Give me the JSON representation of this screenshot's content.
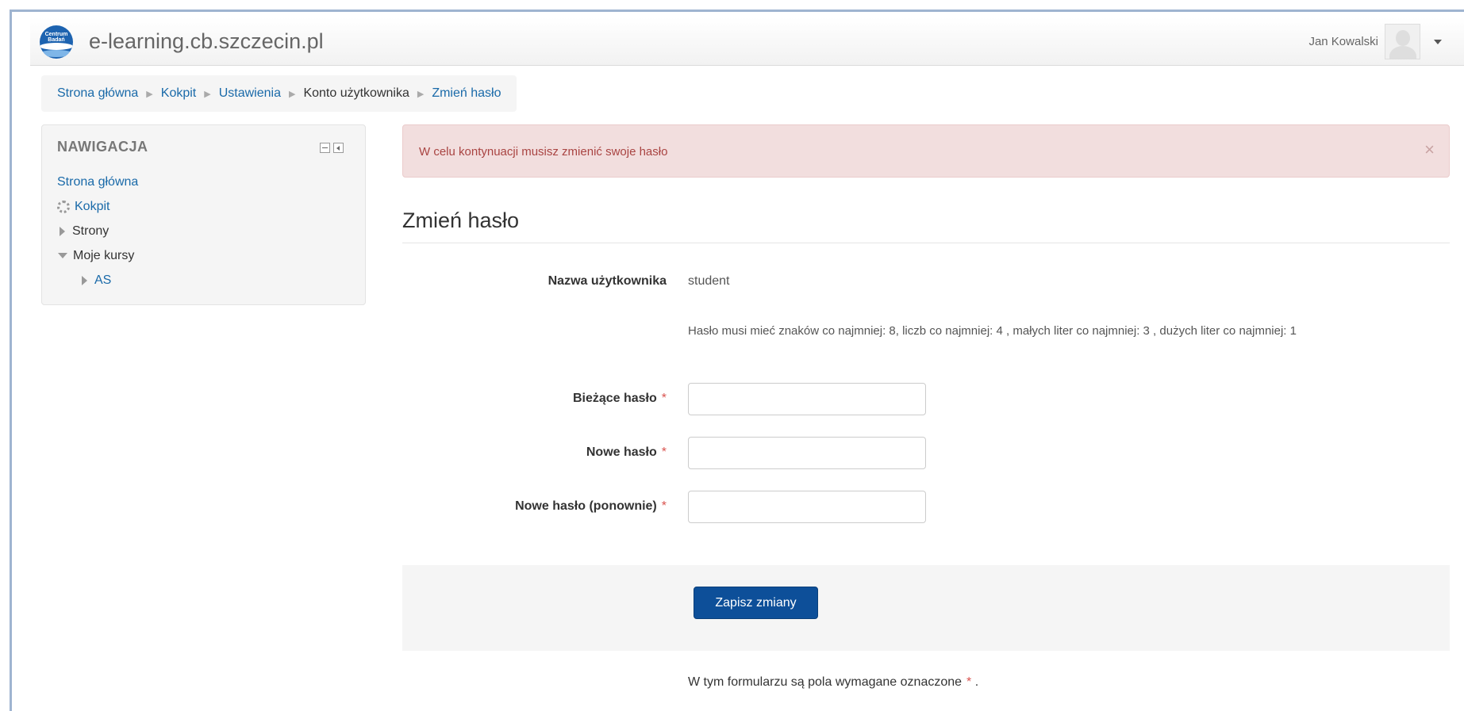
{
  "navbar": {
    "site_name": "e-learning.cb.szczecin.pl",
    "logo_text": "Centrum Badań",
    "user_name": "Jan Kowalski"
  },
  "breadcrumb": [
    {
      "label": "Strona główna"
    },
    {
      "label": "Kokpit"
    },
    {
      "label": "Ustawienia"
    },
    {
      "label": "Konto użytkownika"
    },
    {
      "label": "Zmień hasło"
    }
  ],
  "navigation": {
    "title": "NAWIGACJA",
    "items": [
      {
        "label": "Strona główna"
      },
      {
        "label": "Kokpit"
      },
      {
        "label": "Strony"
      },
      {
        "label": "Moje kursy"
      },
      {
        "label": "AS"
      }
    ]
  },
  "alert": {
    "message": "W celu kontynuacji musisz zmienić swoje hasło",
    "close": "×"
  },
  "page": {
    "title": "Zmień hasło"
  },
  "form": {
    "username_label": "Nazwa użytkownika",
    "username_value": "student",
    "policy": "Hasło musi mieć znaków co najmniej: 8, liczb co najmniej: 4 , małych liter co najmniej: 3 , dużych liter co najmniej: 1",
    "current_label": "Bieżące hasło",
    "new_label": "Nowe hasło",
    "new_again_label": "Nowe hasło (ponownie)",
    "required_mark": "*",
    "current_value": "",
    "new_value": "",
    "new_again_value": "",
    "save_label": "Zapisz zmiany",
    "required_note_prefix": "W tym formularzu są pola wymagane oznaczone",
    "required_note_suffix": "."
  },
  "colors": {
    "link": "#1a6aa9",
    "primary_button": "#0d4f99",
    "alert_bg": "#f2dede",
    "alert_text": "#a94442",
    "required": "#d9534f"
  },
  "icons": [
    "dashboard-icon",
    "expand-icon",
    "collapse-icon",
    "close-icon",
    "user-menu-caret-icon",
    "block-hide-icon",
    "block-dock-icon"
  ]
}
